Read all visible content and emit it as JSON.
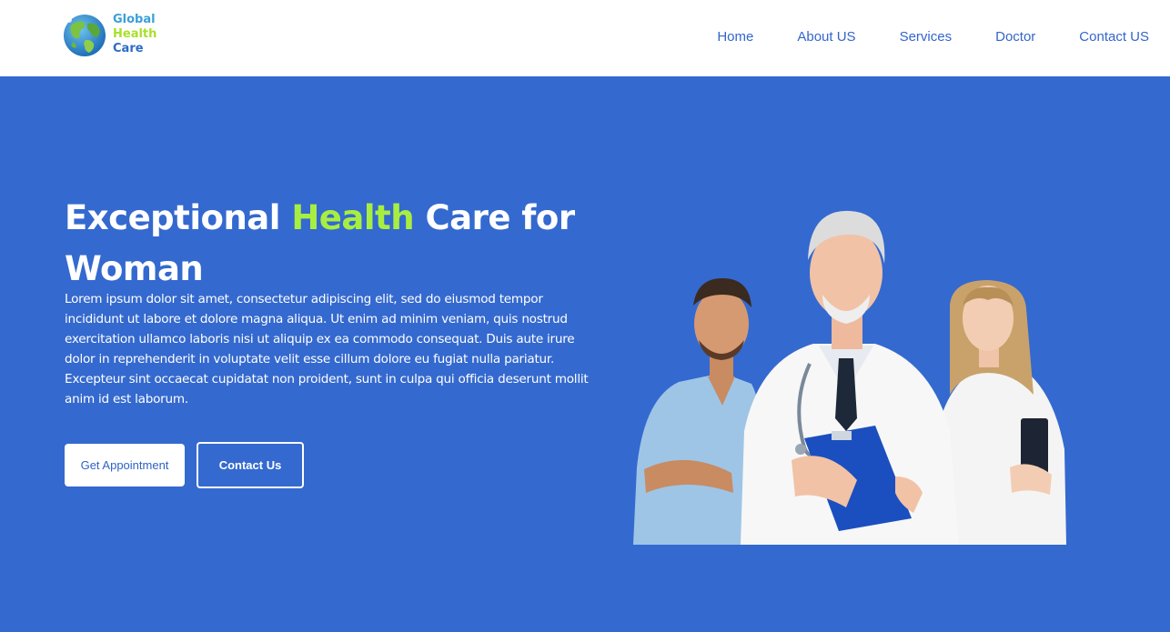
{
  "brand": {
    "line1": "Global",
    "line2": "Health",
    "line3": "Care"
  },
  "nav": {
    "items": [
      {
        "label": "Home"
      },
      {
        "label": "About US"
      },
      {
        "label": "Services"
      },
      {
        "label": "Doctor"
      },
      {
        "label": "Contact US"
      }
    ]
  },
  "hero": {
    "title_part1": "Exceptional ",
    "title_accent": "Health",
    "title_part2": " Care for Woman",
    "body": "Lorem ipsum dolor sit amet, consectetur adipiscing elit, sed do eiusmod tempor incididunt ut labore et dolore magna aliqua. Ut enim ad minim veniam, quis nostrud exercitation ullamco laboris nisi ut aliquip ex ea commodo consequat. Duis aute irure dolor in reprehenderit in voluptate velit esse cillum dolore eu fugiat nulla pariatur. Excepteur sint occaecat cupidatat non proident, sunt in culpa qui officia deserunt mollit anim id est laborum.",
    "primary_button": "Get Appointment",
    "secondary_button": "Contact Us"
  },
  "colors": {
    "hero_bg": "#3469cf",
    "accent": "#a8ee40",
    "nav_link": "#3366cc"
  },
  "icons": {
    "logo": "globe-icon",
    "hero_image": "doctors-image"
  }
}
